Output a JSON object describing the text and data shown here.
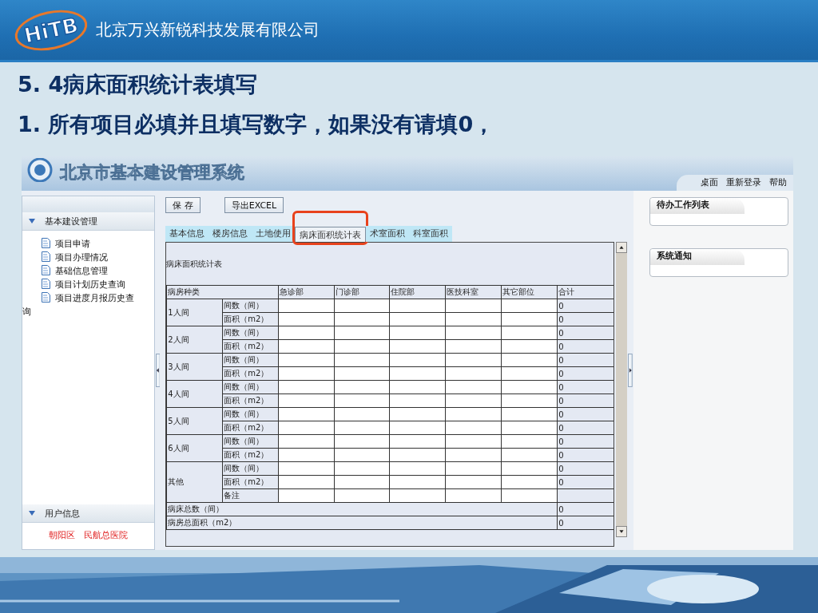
{
  "banner": {
    "logo": "HiTB",
    "company": "北京万兴新锐科技发展有限公司"
  },
  "slide": {
    "heading": "5. 4病床面积统计表填写",
    "note": "1. 所有项目必填并且填写数字，如果没有请填0，"
  },
  "app": {
    "title": "北京市基本建设管理系统",
    "nav": [
      "桌面",
      "重新登录",
      "帮助"
    ],
    "sidebar": {
      "sections": [
        {
          "title": "基本建设管理",
          "expanded": true,
          "items": [
            "项目申请",
            "项目办理情况",
            "基础信息管理",
            "项目计划历史查询",
            "项目进度月报历史查询"
          ]
        },
        {
          "title": "用户信息",
          "expanded": true
        }
      ],
      "user": "朝阳区　民航总医院"
    },
    "toolbar": [
      "保 存",
      "导出EXCEL"
    ],
    "tabs": [
      {
        "label": "基本信息",
        "selected": false,
        "highlighted": false
      },
      {
        "label": "楼房信息",
        "selected": false,
        "highlighted": false
      },
      {
        "label": "土地使用",
        "selected": false,
        "highlighted": false
      },
      {
        "label": "病床面积统计表",
        "selected": true,
        "highlighted": true
      },
      {
        "label": "术室面积",
        "selected": false,
        "highlighted": false
      },
      {
        "label": "科室面积",
        "selected": false,
        "highlighted": false
      }
    ],
    "form": {
      "caption": "病床面积统计表",
      "columns": [
        "病房种类",
        "急诊部",
        "门诊部",
        "住院部",
        "医技科室",
        "其它部位",
        "合计"
      ],
      "groups": [
        {
          "label": "1人间",
          "rows": [
            {
              "label": "间数（间）",
              "total": "0"
            },
            {
              "label": "面积（m2）",
              "total": "0"
            }
          ]
        },
        {
          "label": "2人间",
          "rows": [
            {
              "label": "间数（间）",
              "total": "0"
            },
            {
              "label": "面积（m2）",
              "total": "0"
            }
          ]
        },
        {
          "label": "3人间",
          "rows": [
            {
              "label": "间数（间）",
              "total": "0"
            },
            {
              "label": "面积（m2）",
              "total": "0"
            }
          ]
        },
        {
          "label": "4人间",
          "rows": [
            {
              "label": "间数（间）",
              "total": "0"
            },
            {
              "label": "面积（m2）",
              "total": "0"
            }
          ]
        },
        {
          "label": "5人间",
          "rows": [
            {
              "label": "间数（间）",
              "total": "0"
            },
            {
              "label": "面积（m2）",
              "total": "0"
            }
          ]
        },
        {
          "label": "6人间",
          "rows": [
            {
              "label": "间数（间）",
              "total": "0"
            },
            {
              "label": "面积（m2）",
              "total": "0"
            }
          ]
        },
        {
          "label": "其他",
          "rows": [
            {
              "label": "间数（间）",
              "total": "0"
            },
            {
              "label": "面积（m2）",
              "total": "0"
            },
            {
              "label": "备注"
            }
          ]
        }
      ],
      "totals": [
        {
          "label": "病床总数（间）",
          "total": "0"
        },
        {
          "label": "病房总面积（m2）",
          "total": "0"
        }
      ]
    },
    "panels": [
      {
        "title": "待办工作列表"
      },
      {
        "title": "系统通知"
      }
    ]
  }
}
